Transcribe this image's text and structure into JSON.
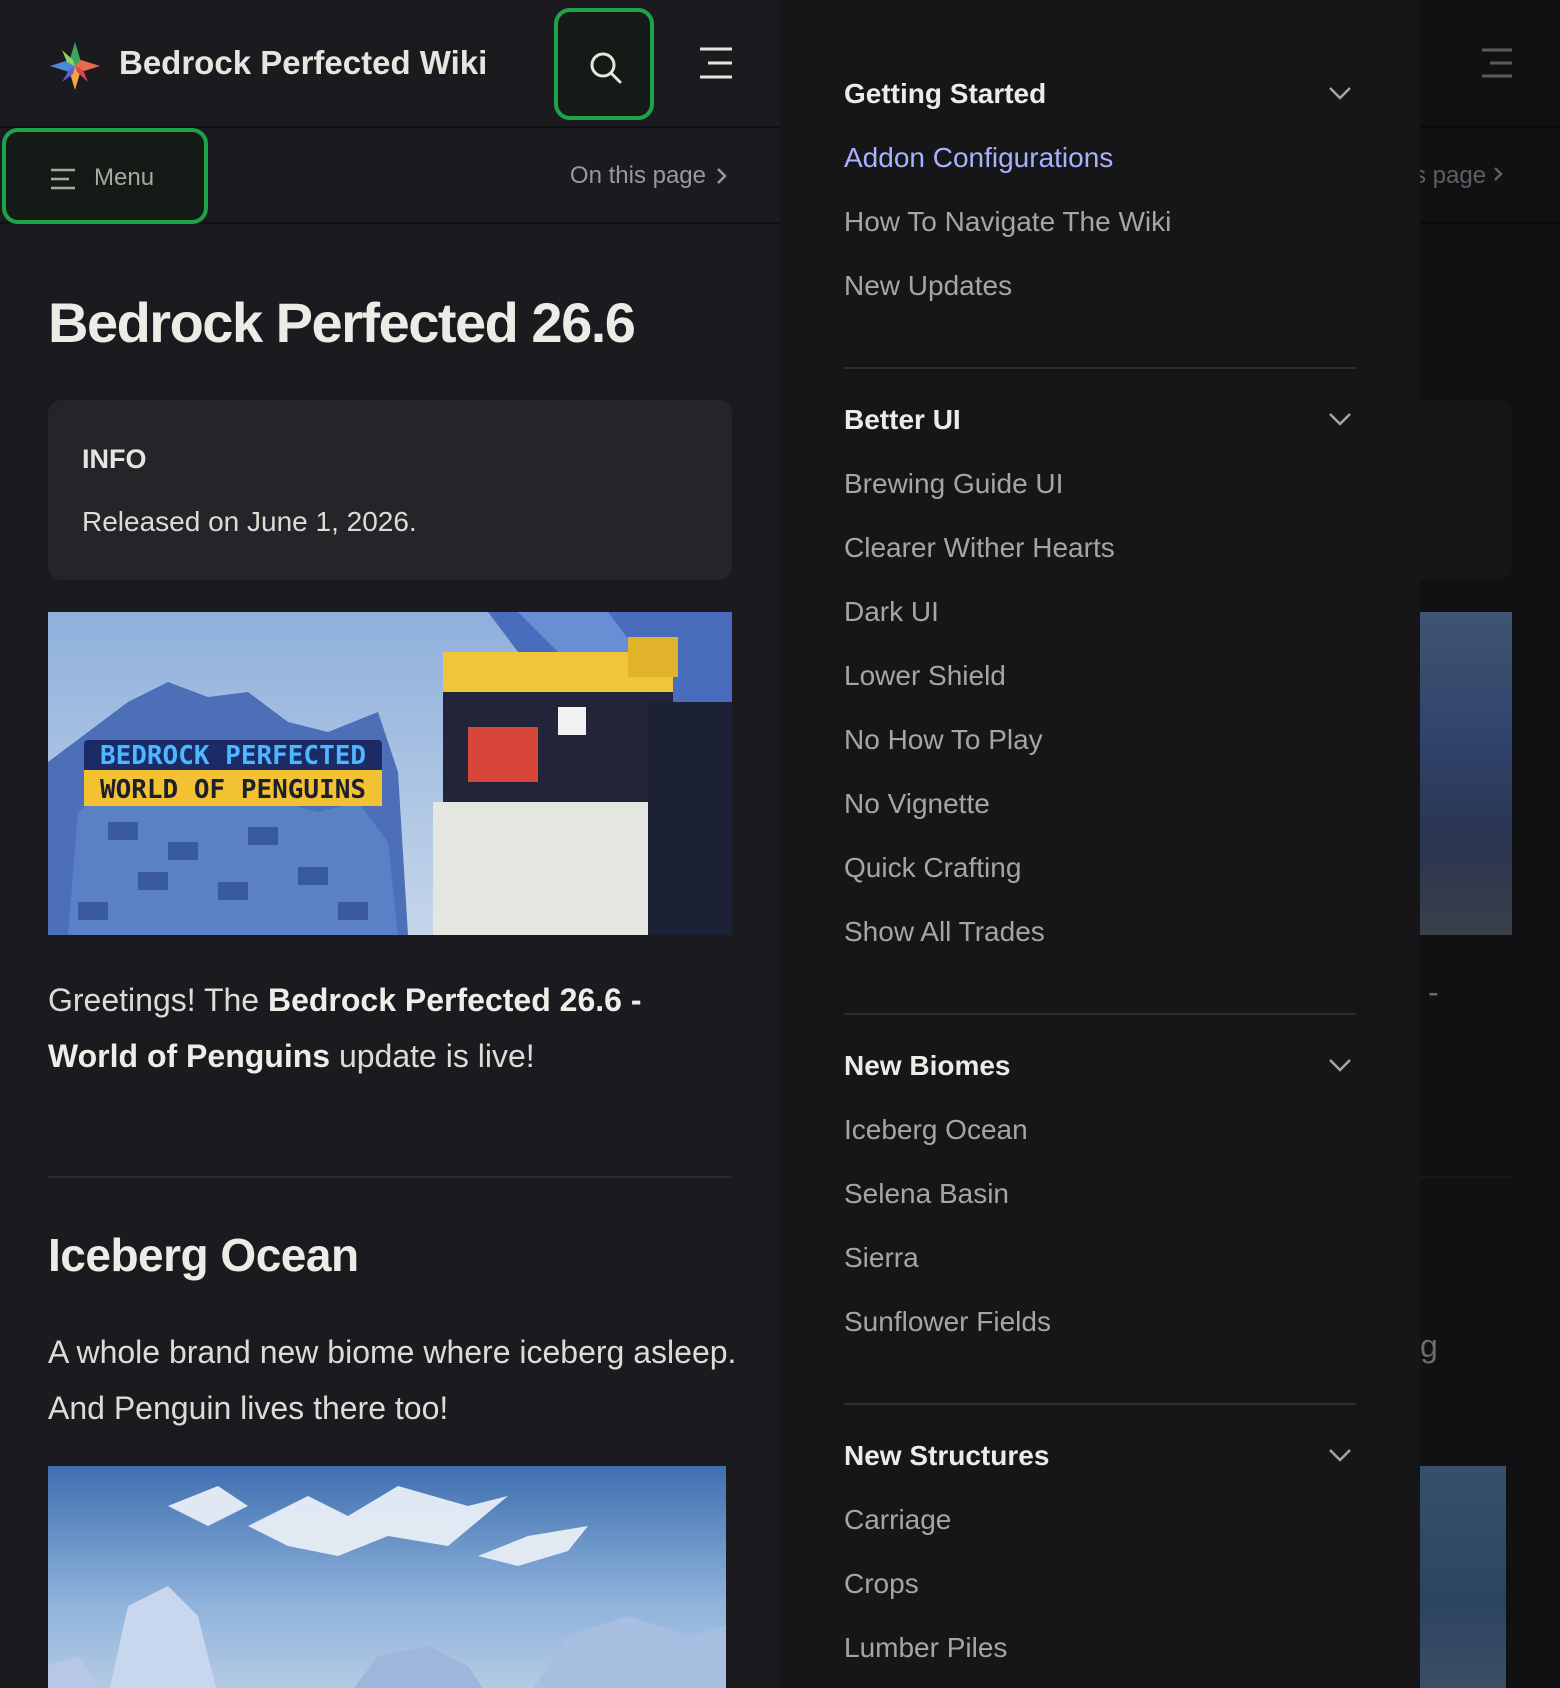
{
  "header": {
    "site_title": "Bedrock Perfected Wiki",
    "search_icon": "search-icon",
    "outline_icon": "outline-menu-icon"
  },
  "subnav": {
    "menu_label": "Menu",
    "on_this_page": "On this page"
  },
  "content": {
    "title": "Bedrock Perfected 26.6",
    "info": {
      "title": "INFO",
      "text": "Released on June 1, 2026."
    },
    "banner_text_line1": "BEDROCK PERFECTED",
    "banner_text_line2": "WORLD OF PENGUINS",
    "intro_prefix": "Greetings! The ",
    "intro_bold": "Bedrock Perfected 26.6 - World of Penguins",
    "intro_suffix": " update is live!",
    "section_title": "Iceberg Ocean",
    "section_text": "A whole brand new biome where iceberg asleep. And Penguin lives there too!"
  },
  "sidebar": {
    "sections": [
      {
        "title": "Getting Started",
        "items": [
          "Addon Configurations",
          "How To Navigate The Wiki",
          "New Updates"
        ]
      },
      {
        "title": "Better UI",
        "items": [
          "Brewing Guide UI",
          "Clearer Wither Hearts",
          "Dark UI",
          "Lower Shield",
          "No How To Play",
          "No Vignette",
          "Quick Crafting",
          "Show All Trades"
        ]
      },
      {
        "title": "New Biomes",
        "items": [
          "Iceberg Ocean",
          "Selena Basin",
          "Sierra",
          "Sunflower Fields"
        ]
      },
      {
        "title": "New Structures",
        "items": [
          "Carriage",
          "Crops",
          "Lumber Piles"
        ]
      }
    ],
    "active_item": "Addon Configurations"
  },
  "backdrop": {
    "otp_fragment": "s page",
    "dash": "-",
    "g_fragment": "g"
  },
  "colors": {
    "background": "#1b1b1f",
    "sidebar_bg": "#161618",
    "active_link": "#a8b1ff",
    "focus_ring": "#1fa34a"
  }
}
